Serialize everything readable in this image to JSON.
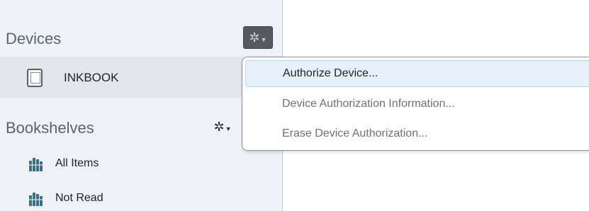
{
  "sidebar": {
    "devices": {
      "title": "Devices",
      "gear_icon": "gear-icon",
      "items": [
        {
          "label": "INKBOOK",
          "icon": "ereader-device-icon"
        }
      ]
    },
    "bookshelves": {
      "title": "Bookshelves",
      "gear_icon": "gear-icon",
      "items": [
        {
          "label": "All Items",
          "icon": "bookshelf-icon"
        },
        {
          "label": "Not Read",
          "icon": "bookshelf-icon"
        }
      ]
    }
  },
  "device_menu": {
    "items": [
      {
        "label": "Authorize Device...",
        "state": "highlighted"
      },
      {
        "label": "Device Authorization Information...",
        "state": "disabled"
      },
      {
        "label": "Erase Device Authorization...",
        "state": "disabled"
      }
    ]
  },
  "colors": {
    "sidebar_bg": "#eef1f6",
    "selected_row_bg": "#e3e6eb",
    "menu_highlight": "#e6f0fa",
    "shelf_icon": "#3a6f86",
    "gear_active_bg": "#555a60"
  }
}
